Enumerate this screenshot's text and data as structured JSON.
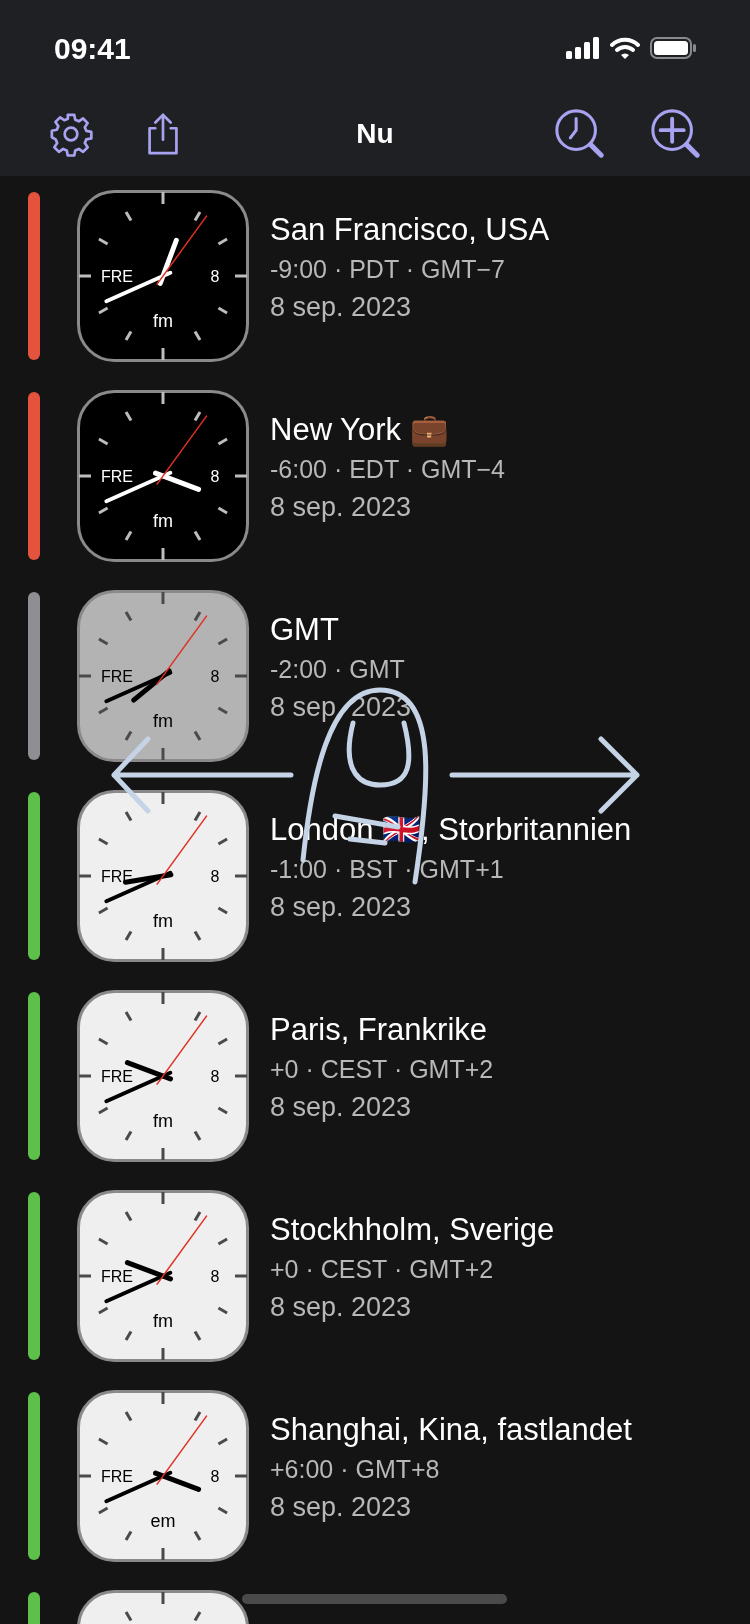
{
  "status_bar": {
    "time": "09:41"
  },
  "nav_bar": {
    "title": "Nu"
  },
  "rows": [
    {
      "name": "San Francisco, USA",
      "offset": "-9:00 · PDT · GMT−7",
      "date": "8 sep. 2023",
      "color": "#e5533d",
      "clock": {
        "kind": "dark",
        "weekday": "FRE",
        "day": "8",
        "period": "fm"
      }
    },
    {
      "name": "New York 💼",
      "offset": "-6:00 · EDT · GMT−4",
      "date": "8 sep. 2023",
      "color": "#e5533d",
      "clock": {
        "kind": "dark",
        "weekday": "FRE",
        "day": "8",
        "period": "fm"
      }
    },
    {
      "name": "GMT",
      "offset": "-2:00 · GMT",
      "date": "8 sep. 2023",
      "color": "#8e8e93",
      "clock": {
        "kind": "gray",
        "weekday": "FRE",
        "day": "8",
        "period": "fm"
      }
    },
    {
      "name": "London 🇬🇧, Storbritannien",
      "offset": "-1:00 · BST · GMT+1",
      "date": "8 sep. 2023",
      "color": "#5ec04a",
      "clock": {
        "kind": "light",
        "weekday": "FRE",
        "day": "8",
        "period": "fm"
      }
    },
    {
      "name": "Paris, Frankrike",
      "offset": "+0 · CEST · GMT+2",
      "date": "8 sep. 2023",
      "color": "#5ec04a",
      "clock": {
        "kind": "light",
        "weekday": "FRE",
        "day": "8",
        "period": "fm"
      }
    },
    {
      "name": "Stockhholm, Sverige",
      "offset": "+0 · CEST · GMT+2",
      "date": "8 sep. 2023",
      "color": "#5ec04a",
      "clock": {
        "kind": "light",
        "weekday": "FRE",
        "day": "8",
        "period": "fm"
      }
    },
    {
      "name": "Shanghai, Kina, fastlandet",
      "offset": "+6:00 · GMT+8",
      "date": "8 sep. 2023",
      "color": "#5ec04a",
      "clock": {
        "kind": "light",
        "weekday": "FRE",
        "day": "8",
        "period": "em"
      }
    },
    {
      "color": "#5ec04a",
      "clock": {
        "kind": "light"
      }
    }
  ]
}
